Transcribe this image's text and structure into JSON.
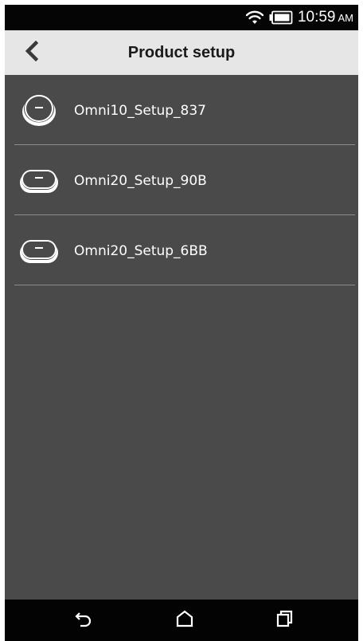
{
  "status_bar": {
    "time": "10:59",
    "ampm": "AM",
    "icons": [
      "wifi-icon",
      "battery-icon"
    ]
  },
  "header": {
    "title": "Product setup",
    "back_icon": "chevron-left-icon"
  },
  "devices": [
    {
      "label": "Omni10_Setup_837",
      "icon": "omni10-device-icon"
    },
    {
      "label": "Omni20_Setup_90B",
      "icon": "omni20-device-icon"
    },
    {
      "label": "Omni20_Setup_6BB",
      "icon": "omni20-device-icon"
    }
  ],
  "nav_bar": {
    "icons": [
      "back-arrow-icon",
      "home-icon",
      "recents-icon"
    ]
  },
  "colors": {
    "status_bar_bg": "#050505",
    "header_bg": "#e6e6e6",
    "content_bg": "#4a4a4a",
    "nav_bar_bg": "#030303",
    "divider": "#8c8c8c",
    "text_light": "#ffffff",
    "text_dark": "#1a1a1a"
  }
}
